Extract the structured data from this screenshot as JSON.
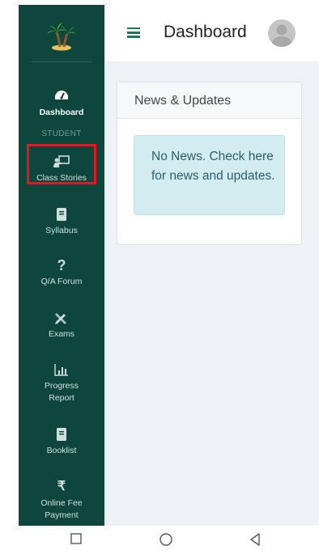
{
  "sidebar": {
    "items": [
      {
        "label": "Dashboard",
        "icon": "gauge-icon"
      },
      {
        "label": "Class Stories",
        "icon": "teacher-board-icon"
      },
      {
        "label": "Syllabus",
        "icon": "book-icon"
      },
      {
        "label": "Q/A Forum",
        "icon": "question-icon"
      },
      {
        "label": "Exams",
        "icon": "pencil-ruler-icon"
      },
      {
        "label": "Progress Report",
        "icon": "bar-chart-icon"
      },
      {
        "label": "Booklist",
        "icon": "book-icon"
      },
      {
        "label": "Online Fee Payment",
        "icon": "rupee-icon"
      }
    ],
    "section_label": "STUDENT",
    "active_index": 0
  },
  "header": {
    "title": "Dashboard"
  },
  "news": {
    "title": "News & Updates",
    "message": "No News. Check here for news and updates."
  },
  "colors": {
    "sidebar_bg": "#0e463e",
    "accent": "#1f6f63",
    "highlight": "#e8141e",
    "alert_bg": "#d3ecef"
  }
}
